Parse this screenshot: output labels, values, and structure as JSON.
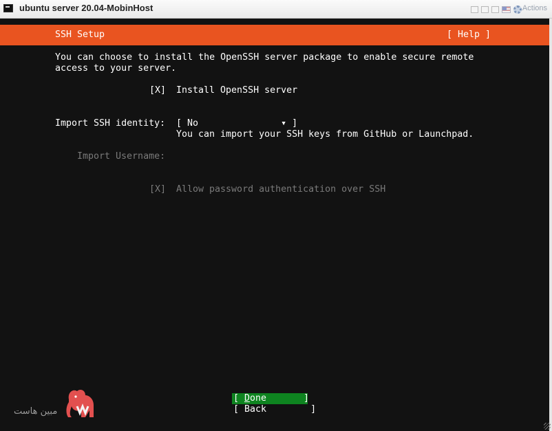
{
  "window": {
    "title": "ubuntu server 20.04-MobinHost",
    "actions_label": "Actions",
    "toolbar_icons": [
      "window-restore-icon",
      "window-minimize-icon",
      "window-maximize-icon",
      "keyboard-flag-icon",
      "gear-icon"
    ]
  },
  "installer": {
    "header_title": "SSH Setup",
    "help_label": "[ Help ]",
    "intro_line1": "You can choose to install the OpenSSH server package to enable secure remote",
    "intro_line2": "access to your server.",
    "install_ssh_checkbox": "[X]",
    "install_ssh_label": "Install OpenSSH server",
    "import_identity_label": "Import SSH identity:",
    "import_identity_value": "[ No               ▾ ]",
    "import_identity_hint": "You can import your SSH keys from GitHub or Launchpad.",
    "import_username_label": "Import Username:",
    "allow_password_checkbox": "[X]",
    "allow_password_label": "Allow password authentication over SSH",
    "done_open": "[ ",
    "done_mnemonic": "D",
    "done_rest": "one",
    "done_close": "]",
    "back_label": "[ Back        ]"
  },
  "watermark": {
    "text": "مبین هاست"
  },
  "colors": {
    "header_orange": "#e95420",
    "done_green": "#0e8420",
    "terminal_bg": "#121212",
    "disabled_text": "#7a7a7a"
  }
}
